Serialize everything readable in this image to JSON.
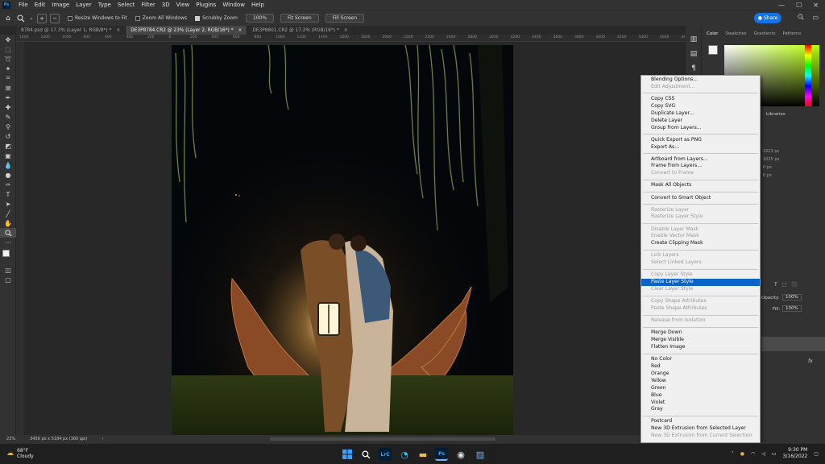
{
  "menubar": {
    "app_icon": "Ps",
    "items": [
      "File",
      "Edit",
      "Image",
      "Layer",
      "Type",
      "Select",
      "Filter",
      "3D",
      "View",
      "Plugins",
      "Window",
      "Help"
    ]
  },
  "options_bar": {
    "resize_windows": "Resize Windows to Fit",
    "zoom_all": "Zoom All Windows",
    "scrubby_zoom": "Scrubby Zoom",
    "zoom_value": "100%",
    "fit_screen": "Fit Screen",
    "fill_screen": "Fill Screen",
    "share": "Share"
  },
  "tabs": [
    "8784.psd @ 17.3% (Layer 1, RGB/8*) *",
    "DE3P8784.CR2 @ 23% (Layer 2, RGB/16*) *",
    "DE3P8801.CR2 @ 17.2% (RGB/16*) *"
  ],
  "rulers": {
    "ticks": [
      "1400",
      "1200",
      "1000",
      "800",
      "600",
      "400",
      "200",
      "0",
      "200",
      "400",
      "600",
      "800",
      "1000",
      "1200",
      "1400",
      "1600",
      "1800",
      "2000",
      "2200",
      "2400",
      "2600",
      "2800",
      "3000",
      "3200",
      "3400",
      "3600",
      "3800",
      "4000",
      "4200",
      "4400",
      "4600",
      "4800"
    ]
  },
  "status": {
    "zoom": "23%",
    "doc_size": "3456 px x 5184 px (300 ppi)"
  },
  "panels": {
    "tabs": [
      "Color",
      "Swatches",
      "Gradients",
      "Patterns"
    ],
    "libraries": "Libraries",
    "opacity_label": "Opacity:",
    "opacity_value": "100%",
    "fill_label": "Fill:",
    "fill_value": "100%",
    "fx": "fx",
    "side_values": [
      "3223 px",
      "1025 px",
      "0 px",
      "0 px"
    ]
  },
  "context_menu": {
    "groups": [
      [
        {
          "label": "Blending Options...",
          "enabled": true
        },
        {
          "label": "Edit Adjustment...",
          "enabled": false
        }
      ],
      [
        {
          "label": "Copy CSS",
          "enabled": true
        },
        {
          "label": "Copy SVG",
          "enabled": true
        },
        {
          "label": "Duplicate Layer...",
          "enabled": true
        },
        {
          "label": "Delete Layer",
          "enabled": true
        },
        {
          "label": "Group from Layers...",
          "enabled": true
        }
      ],
      [
        {
          "label": "Quick Export as PNG",
          "enabled": true
        },
        {
          "label": "Export As...",
          "enabled": true
        }
      ],
      [
        {
          "label": "Artboard from Layers...",
          "enabled": true
        },
        {
          "label": "Frame from Layers...",
          "enabled": true
        },
        {
          "label": "Convert to Frame",
          "enabled": false
        }
      ],
      [
        {
          "label": "Mask All Objects",
          "enabled": true
        }
      ],
      [
        {
          "label": "Convert to Smart Object",
          "enabled": true
        }
      ],
      [
        {
          "label": "Rasterize Layer",
          "enabled": false
        },
        {
          "label": "Rasterize Layer Style",
          "enabled": false
        }
      ],
      [
        {
          "label": "Disable Layer Mask",
          "enabled": false
        },
        {
          "label": "Enable Vector Mask",
          "enabled": false
        },
        {
          "label": "Create Clipping Mask",
          "enabled": true
        }
      ],
      [
        {
          "label": "Link Layers",
          "enabled": false
        },
        {
          "label": "Select Linked Layers",
          "enabled": false
        }
      ],
      [
        {
          "label": "Copy Layer Style",
          "enabled": false
        },
        {
          "label": "Paste Layer Style",
          "enabled": true,
          "highlighted": true
        },
        {
          "label": "Clear Layer Style",
          "enabled": false
        }
      ],
      [
        {
          "label": "Copy Shape Attributes",
          "enabled": false
        },
        {
          "label": "Paste Shape Attributes",
          "enabled": false
        }
      ],
      [
        {
          "label": "Release from Isolation",
          "enabled": false
        }
      ],
      [
        {
          "label": "Merge Down",
          "enabled": true
        },
        {
          "label": "Merge Visible",
          "enabled": true
        },
        {
          "label": "Flatten Image",
          "enabled": true
        }
      ],
      [
        {
          "label": "No Color",
          "enabled": true
        },
        {
          "label": "Red",
          "enabled": true
        },
        {
          "label": "Orange",
          "enabled": true
        },
        {
          "label": "Yellow",
          "enabled": true
        },
        {
          "label": "Green",
          "enabled": true
        },
        {
          "label": "Blue",
          "enabled": true
        },
        {
          "label": "Violet",
          "enabled": true
        },
        {
          "label": "Gray",
          "enabled": true
        }
      ],
      [
        {
          "label": "Postcard",
          "enabled": true
        },
        {
          "label": "New 3D Extrusion from Selected Layer",
          "enabled": true
        },
        {
          "label": "New 3D Extrusion from Current Selection",
          "enabled": false
        }
      ]
    ]
  },
  "taskbar": {
    "temperature": "68°F",
    "condition": "Cloudy",
    "time": "9:30 PM",
    "date": "3/16/2022",
    "lrc": "LrC",
    "ps": "Ps"
  },
  "colors": {
    "accent": "#1473e6",
    "menu_highlight": "#0a64c8"
  }
}
